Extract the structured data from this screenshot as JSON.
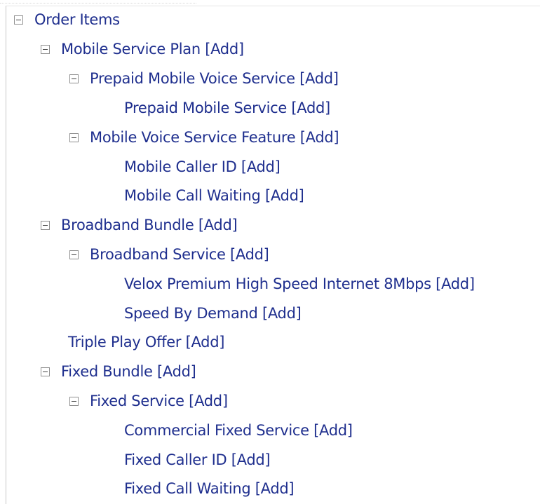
{
  "tree": {
    "items": [
      {
        "label": "Order Items",
        "toggle": "collapse"
      },
      {
        "label": "Mobile Service Plan [Add]",
        "toggle": "collapse"
      },
      {
        "label": "Prepaid Mobile Voice Service [Add]",
        "toggle": "collapse"
      },
      {
        "label": "Prepaid Mobile Service [Add]"
      },
      {
        "label": "Mobile Voice Service Feature [Add]",
        "toggle": "collapse"
      },
      {
        "label": "Mobile Caller ID [Add]"
      },
      {
        "label": "Mobile Call Waiting [Add]"
      },
      {
        "label": "Broadband Bundle [Add]",
        "toggle": "collapse"
      },
      {
        "label": "Broadband Service [Add]",
        "toggle": "collapse"
      },
      {
        "label": "Velox Premium High Speed Internet 8Mbps [Add]"
      },
      {
        "label": "Speed By Demand [Add]"
      },
      {
        "label": "Triple Play Offer [Add]"
      },
      {
        "label": "Fixed Bundle [Add]",
        "toggle": "collapse"
      },
      {
        "label": "Fixed Service [Add]",
        "toggle": "collapse"
      },
      {
        "label": "Commercial Fixed Service [Add]"
      },
      {
        "label": "Fixed Caller ID [Add]"
      },
      {
        "label": "Fixed Call Waiting [Add]"
      }
    ]
  },
  "colors": {
    "link_text": "#1f2f8e",
    "toggle_border": "#8f8f8f"
  },
  "icons": {
    "toggle": "minus-box-icon"
  }
}
